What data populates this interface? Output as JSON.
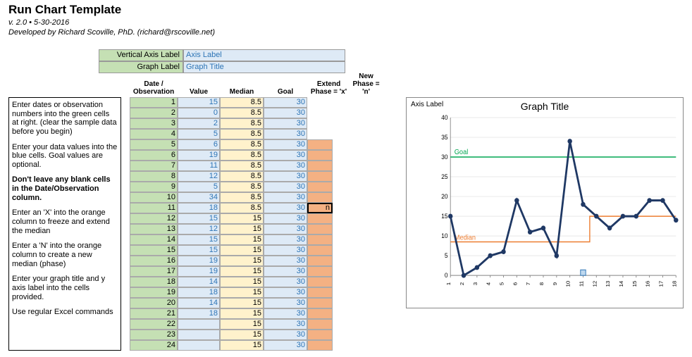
{
  "header": {
    "title": "Run Chart Template",
    "version": "v. 2.0 • 5-30-2016",
    "author": "Developed by Richard Scoville, PhD. (richard@rscoville.net)"
  },
  "labels": {
    "axis_label_lab": "Vertical Axis Label",
    "axis_label_val": "Axis Label",
    "graph_label_lab": "Graph Label",
    "graph_label_val": "Graph Title"
  },
  "columns": {
    "date": "Date / Observation",
    "value": "Value",
    "median": "Median",
    "goal": "Goal",
    "phase1": "Extend Phase  = 'x'",
    "phase2": "New Phase = 'n'"
  },
  "instructions": {
    "p1": "Enter dates or observation numbers into the green cells at right.  (clear the sample data before you begin)",
    "p2": "Enter your data values into the blue cells. Goal values are optional.",
    "p3": "Don't leave any blank cells in the Date/Observation column.",
    "p4": "Enter an 'X' into the orange column to freeze and extend the median",
    "p5": "Enter a 'N' into the orange column to create a new median (phase)",
    "p6": "Enter your graph title and y axis label into the cells provided.",
    "p7": "Use regular Excel commands"
  },
  "rows": [
    {
      "d": "1",
      "v": "15",
      "m": "8.5",
      "g": "30",
      "p": ""
    },
    {
      "d": "2",
      "v": "0",
      "m": "8.5",
      "g": "30",
      "p": ""
    },
    {
      "d": "3",
      "v": "2",
      "m": "8.5",
      "g": "30",
      "p": ""
    },
    {
      "d": "4",
      "v": "5",
      "m": "8.5",
      "g": "30",
      "p": ""
    },
    {
      "d": "5",
      "v": "6",
      "m": "8.5",
      "g": "30",
      "p": ""
    },
    {
      "d": "6",
      "v": "19",
      "m": "8.5",
      "g": "30",
      "p": ""
    },
    {
      "d": "7",
      "v": "11",
      "m": "8.5",
      "g": "30",
      "p": ""
    },
    {
      "d": "8",
      "v": "12",
      "m": "8.5",
      "g": "30",
      "p": ""
    },
    {
      "d": "9",
      "v": "5",
      "m": "8.5",
      "g": "30",
      "p": ""
    },
    {
      "d": "10",
      "v": "34",
      "m": "8.5",
      "g": "30",
      "p": ""
    },
    {
      "d": "11",
      "v": "18",
      "m": "8.5",
      "g": "30",
      "p": "n"
    },
    {
      "d": "12",
      "v": "15",
      "m": "15",
      "g": "30",
      "p": ""
    },
    {
      "d": "13",
      "v": "12",
      "m": "15",
      "g": "30",
      "p": ""
    },
    {
      "d": "14",
      "v": "15",
      "m": "15",
      "g": "30",
      "p": ""
    },
    {
      "d": "15",
      "v": "15",
      "m": "15",
      "g": "30",
      "p": ""
    },
    {
      "d": "16",
      "v": "19",
      "m": "15",
      "g": "30",
      "p": ""
    },
    {
      "d": "17",
      "v": "19",
      "m": "15",
      "g": "30",
      "p": ""
    },
    {
      "d": "18",
      "v": "14",
      "m": "15",
      "g": "30",
      "p": ""
    },
    {
      "d": "19",
      "v": "18",
      "m": "15",
      "g": "30",
      "p": ""
    },
    {
      "d": "20",
      "v": "14",
      "m": "15",
      "g": "30",
      "p": ""
    },
    {
      "d": "21",
      "v": "18",
      "m": "15",
      "g": "30",
      "p": ""
    },
    {
      "d": "22",
      "v": "",
      "m": "15",
      "g": "30",
      "p": ""
    },
    {
      "d": "23",
      "v": "",
      "m": "15",
      "g": "30",
      "p": ""
    },
    {
      "d": "24",
      "v": "",
      "m": "15",
      "g": "30",
      "p": ""
    }
  ],
  "chart_data": {
    "type": "line",
    "title": "Graph Title",
    "ylabel": "Axis Label",
    "ylim": [
      0,
      40
    ],
    "yticks": [
      0,
      5,
      10,
      15,
      20,
      25,
      30,
      35,
      40
    ],
    "x": [
      1,
      2,
      3,
      4,
      5,
      6,
      7,
      8,
      9,
      10,
      11,
      12,
      13,
      14,
      15,
      16,
      17,
      18
    ],
    "series": [
      {
        "name": "Value",
        "values": [
          15,
          0,
          2,
          5,
          6,
          19,
          11,
          12,
          5,
          34,
          18,
          15,
          12,
          15,
          15,
          19,
          19,
          14
        ]
      },
      {
        "name": "Median",
        "values": [
          8.5,
          8.5,
          8.5,
          8.5,
          8.5,
          8.5,
          8.5,
          8.5,
          8.5,
          8.5,
          8.5,
          15,
          15,
          15,
          15,
          15,
          15,
          15
        ]
      },
      {
        "name": "Goal",
        "values": [
          30,
          30,
          30,
          30,
          30,
          30,
          30,
          30,
          30,
          30,
          30,
          30,
          30,
          30,
          30,
          30,
          30,
          30
        ]
      }
    ],
    "annotations": {
      "goal_label": "Goal",
      "median_label": "Median"
    }
  }
}
